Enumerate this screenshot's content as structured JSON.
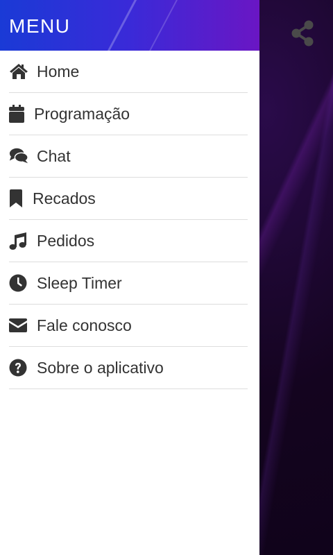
{
  "header": {
    "title": "MENU"
  },
  "menu": {
    "items": [
      {
        "label": "Home",
        "icon": "home-icon"
      },
      {
        "label": "Programação",
        "icon": "calendar-icon"
      },
      {
        "label": "Chat",
        "icon": "chat-icon"
      },
      {
        "label": "Recados",
        "icon": "bookmark-icon"
      },
      {
        "label": "Pedidos",
        "icon": "music-icon"
      },
      {
        "label": "Sleep Timer",
        "icon": "clock-icon"
      },
      {
        "label": "Fale conosco",
        "icon": "envelope-icon"
      },
      {
        "label": "Sobre o aplicativo",
        "icon": "question-icon"
      }
    ]
  },
  "toolbar": {
    "share_icon": "share-icon"
  },
  "colors": {
    "header_start": "#1a3ad6",
    "header_end": "#6a16c4",
    "icon": "#333333",
    "text": "#333333",
    "divider": "#dddddd"
  }
}
